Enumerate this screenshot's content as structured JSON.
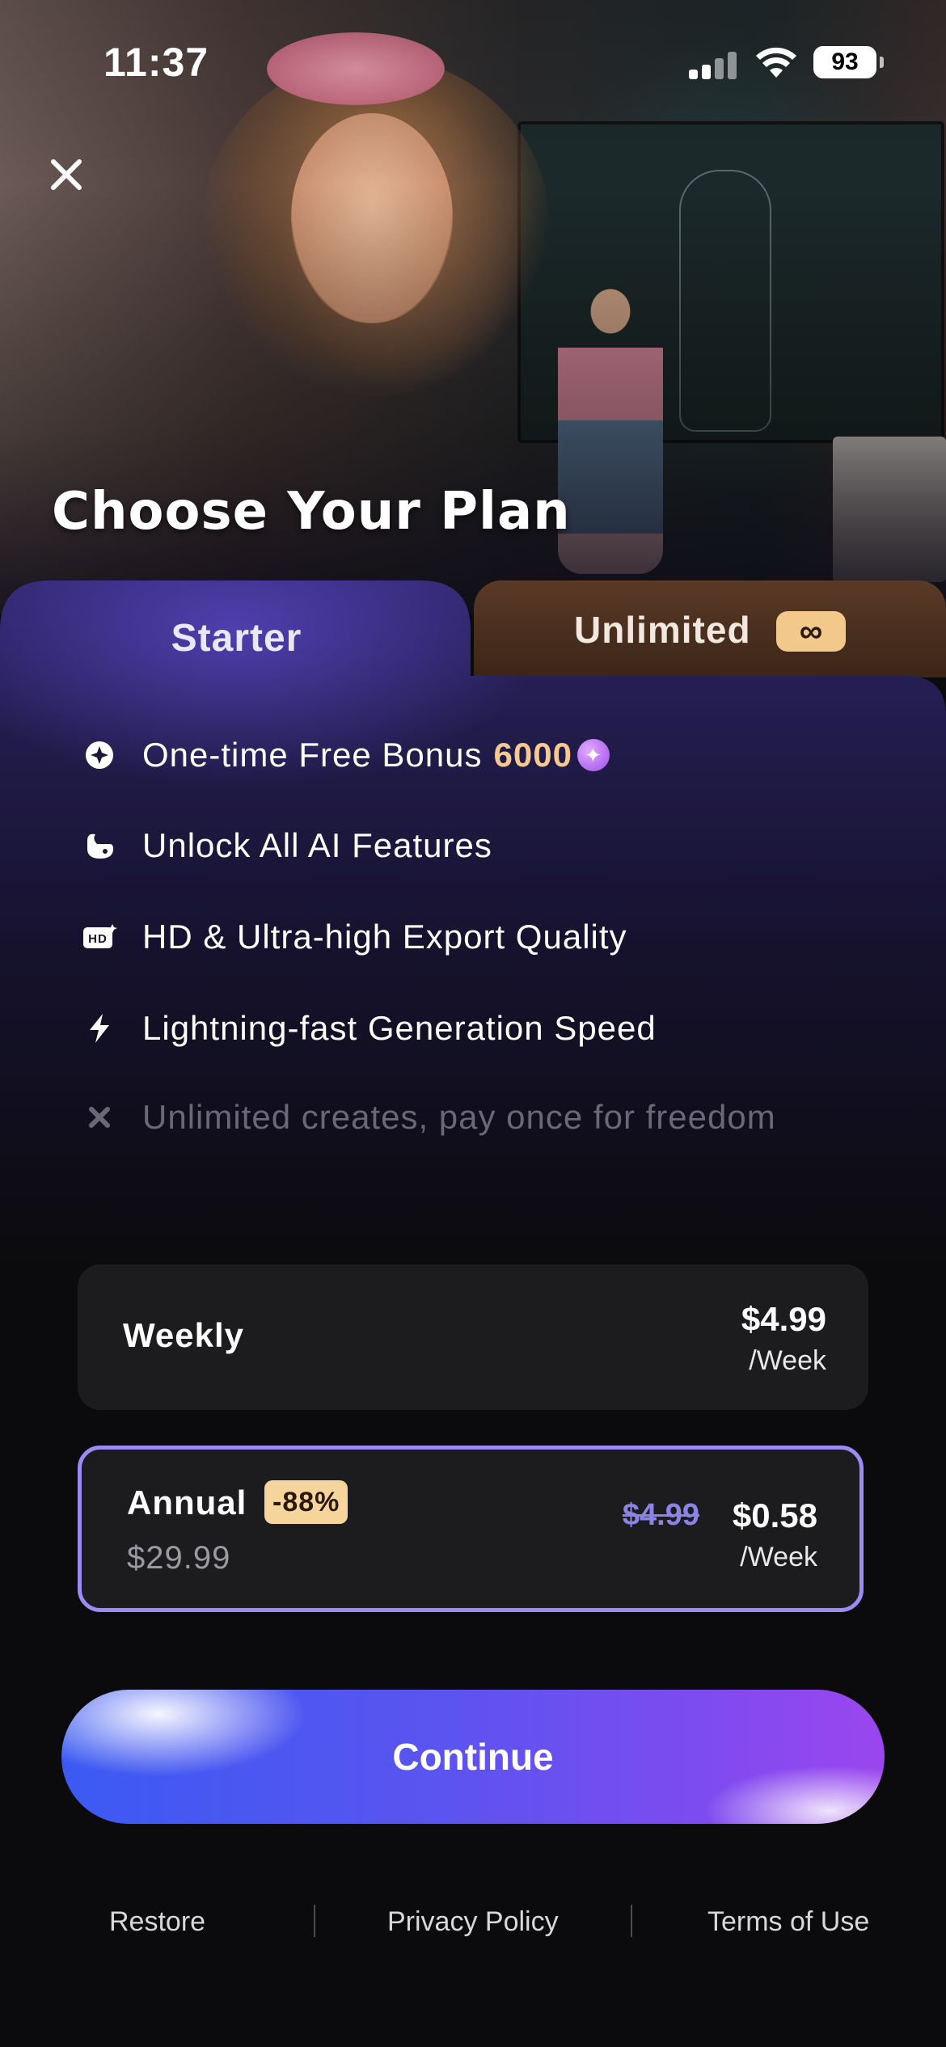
{
  "status_bar": {
    "time": "11:37",
    "battery": "93"
  },
  "header": {
    "close_icon": "close-icon",
    "title": "Choose Your Plan"
  },
  "tabs": [
    {
      "label": "Starter",
      "active": true
    },
    {
      "label": "Unlimited",
      "badge": "∞",
      "active": false
    }
  ],
  "features": [
    {
      "icon": "sparkle-coin-icon",
      "text": "One-time Free Bonus",
      "highlight": "6000",
      "included": true
    },
    {
      "icon": "unlock-icon",
      "text": "Unlock All AI Features",
      "included": true
    },
    {
      "icon": "hd-icon",
      "text": "HD & Ultra-high Export Quality",
      "included": true
    },
    {
      "icon": "lightning-icon",
      "text": "Lightning-fast Generation Speed",
      "included": true
    },
    {
      "icon": "x-icon",
      "text": "Unlimited creates, pay once for freedom",
      "included": false
    }
  ],
  "plans": {
    "weekly": {
      "name": "Weekly",
      "price": "$4.99",
      "unit": "/Week"
    },
    "annual": {
      "name": "Annual",
      "discount": "-88%",
      "total": "$29.99",
      "original_price": "$4.99",
      "price": "$0.58",
      "unit": "/Week",
      "selected": true
    }
  },
  "continue_label": "Continue",
  "footer": {
    "restore": "Restore",
    "privacy": "Privacy Policy",
    "terms": "Terms of Use"
  },
  "colors": {
    "accent": "#9b8cf5",
    "bonus": "#f6c98e",
    "badge": "#f5d59b"
  }
}
